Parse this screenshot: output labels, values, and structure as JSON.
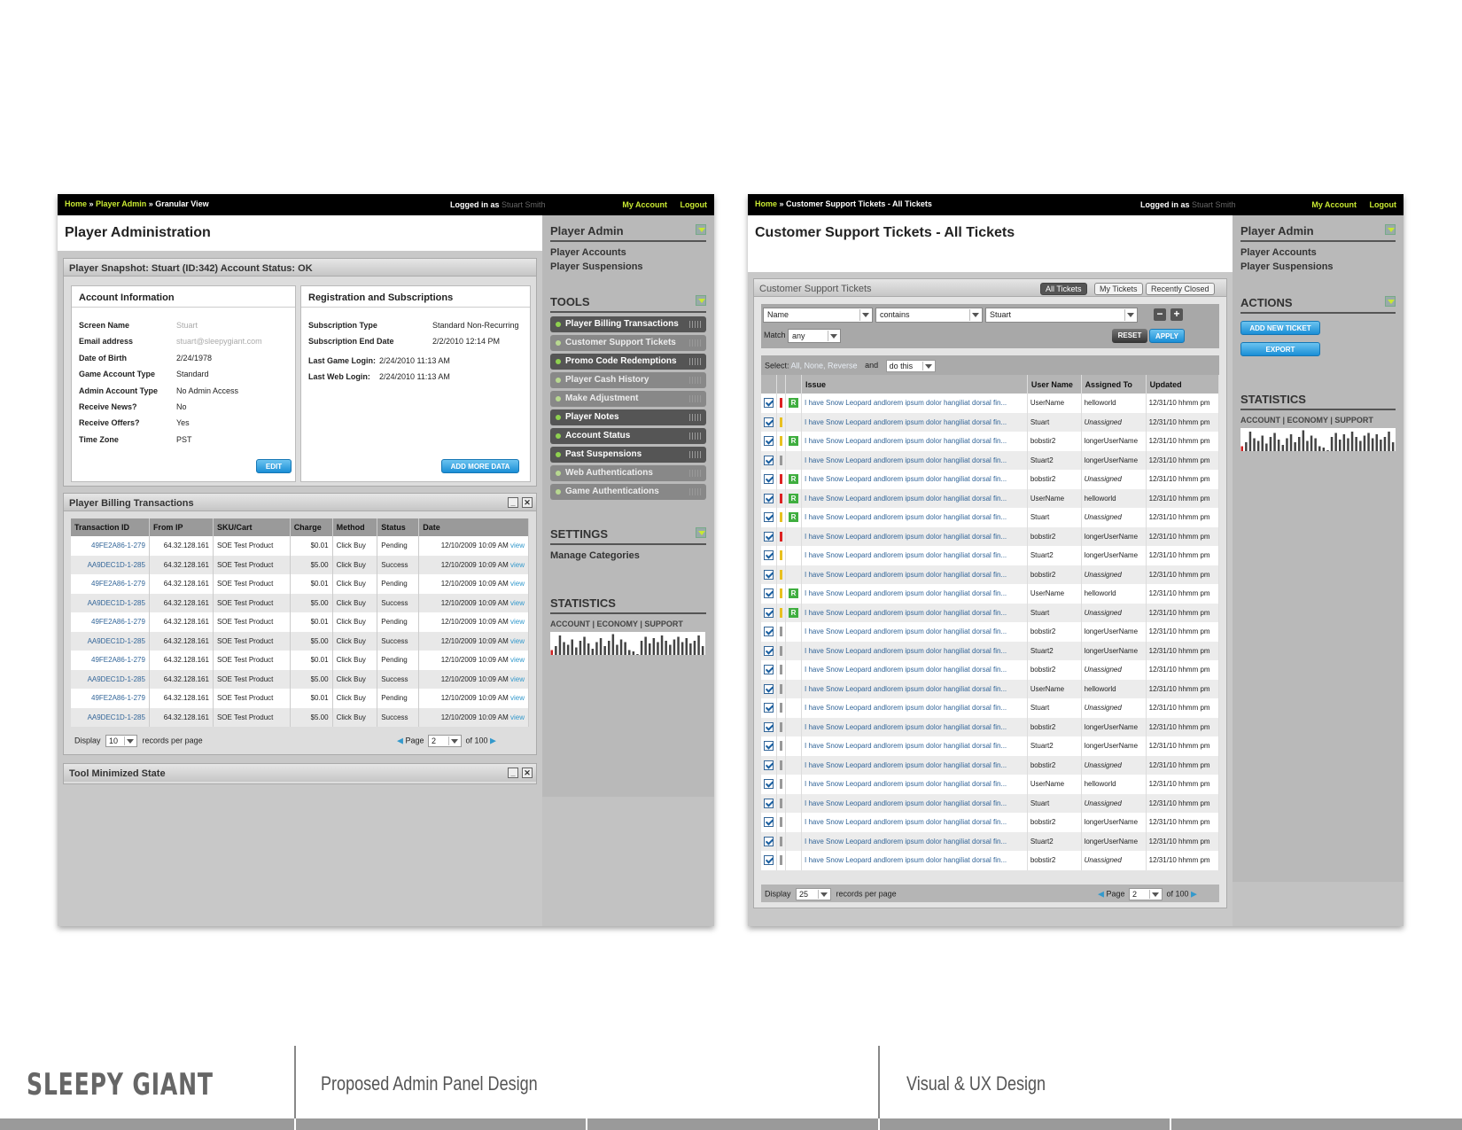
{
  "left": {
    "crumbs": {
      "home": "Home",
      "sep1": " » ",
      "admin": "Player Admin",
      "sep2": " » ",
      "current": "Granular View"
    },
    "login": {
      "label": "Logged in as ",
      "user": "Stuart Smith"
    },
    "my_account": "My Account",
    "logout": "Logout",
    "page_title": "Player Administration",
    "snapshot_title": "Player Snapshot: Stuart (ID:342) Account Status: OK",
    "account_info": {
      "title": "Account Information",
      "rows": [
        {
          "k": "Screen Name",
          "v": "Stuart"
        },
        {
          "k": "Email address",
          "v": "stuart@sleepygiant.com"
        },
        {
          "k": "Date of Birth",
          "v": "2/24/1978"
        },
        {
          "k": "Game Account Type",
          "v": "Standard"
        },
        {
          "k": "Admin Account Type",
          "v": "No Admin Access"
        },
        {
          "k": "Receive News?",
          "v": "No"
        },
        {
          "k": "Receive Offers?",
          "v": "Yes"
        },
        {
          "k": "Time Zone",
          "v": "PST"
        }
      ],
      "edit": "EDIT"
    },
    "registration": {
      "title": "Registration and Subscriptions",
      "rows": [
        {
          "k": "Subscription Type",
          "v": "Standard Non-Recurring"
        },
        {
          "k": "Subscription End Date",
          "v": "2/2/2010 12:14 PM"
        },
        {
          "k": "Last Game Login:",
          "v": "2/24/2010 11:13 AM"
        },
        {
          "k": "Last Web Login:",
          "v": "2/24/2010 11:13 AM"
        }
      ],
      "add": "ADD MORE DATA"
    },
    "billing": {
      "title": "Player Billing Transactions",
      "columns": [
        "Transaction ID",
        "From IP",
        "SKU/Cart",
        "Charge",
        "Method",
        "Status",
        "Date"
      ],
      "rows": [
        [
          "49FE2A86-1-279",
          "64.32.128.161",
          "SOE Test Product",
          "$0.01",
          "Click Buy",
          "Pending",
          "12/10/2009 10:09 AM"
        ],
        [
          "AA9DEC1D-1-285",
          "64.32.128.161",
          "SOE Test Product",
          "$5.00",
          "Click Buy",
          "Success",
          "12/10/2009 10:09 AM"
        ],
        [
          "49FE2A86-1-279",
          "64.32.128.161",
          "SOE Test Product",
          "$0.01",
          "Click Buy",
          "Pending",
          "12/10/2009 10:09 AM"
        ],
        [
          "AA9DEC1D-1-285",
          "64.32.128.161",
          "SOE Test Product",
          "$5.00",
          "Click Buy",
          "Success",
          "12/10/2009 10:09 AM"
        ],
        [
          "49FE2A86-1-279",
          "64.32.128.161",
          "SOE Test Product",
          "$0.01",
          "Click Buy",
          "Pending",
          "12/10/2009 10:09 AM"
        ],
        [
          "AA9DEC1D-1-285",
          "64.32.128.161",
          "SOE Test Product",
          "$5.00",
          "Click Buy",
          "Success",
          "12/10/2009 10:09 AM"
        ],
        [
          "49FE2A86-1-279",
          "64.32.128.161",
          "SOE Test Product",
          "$0.01",
          "Click Buy",
          "Pending",
          "12/10/2009 10:09 AM"
        ],
        [
          "AA9DEC1D-1-285",
          "64.32.128.161",
          "SOE Test Product",
          "$5.00",
          "Click Buy",
          "Success",
          "12/10/2009 10:09 AM"
        ],
        [
          "49FE2A86-1-279",
          "64.32.128.161",
          "SOE Test Product",
          "$0.01",
          "Click Buy",
          "Pending",
          "12/10/2009 10:09 AM"
        ],
        [
          "AA9DEC1D-1-285",
          "64.32.128.161",
          "SOE Test Product",
          "$5.00",
          "Click Buy",
          "Success",
          "12/10/2009 10:09 AM"
        ]
      ],
      "view": "view",
      "display_label": "Display",
      "display_value": "10",
      "records_label": "records per page",
      "page_label": "Page",
      "page_value": "2",
      "of_label": "of 100"
    },
    "minimized_title": "Tool Minimized State",
    "sidebar": {
      "player_admin": "Player Admin",
      "links": [
        "Player Accounts",
        "Player Suspensions"
      ],
      "tools_title": "TOOLS",
      "tools": [
        {
          "label": "Player Billing Transactions",
          "style": "dk"
        },
        {
          "label": "Customer Support Tickets",
          "style": "lt"
        },
        {
          "label": "Promo Code Redemptions",
          "style": "dk"
        },
        {
          "label": "Player Cash History",
          "style": "lt"
        },
        {
          "label": "Make Adjustment",
          "style": "lt"
        },
        {
          "label": "Player Notes",
          "style": "dk"
        },
        {
          "label": "Account Status",
          "style": "dk"
        },
        {
          "label": "Past Suspensions",
          "style": "dk"
        },
        {
          "label": "Web Authentications",
          "style": "lt"
        },
        {
          "label": "Game Authentications",
          "style": "lt"
        }
      ],
      "settings_title": "SETTINGS",
      "settings_link": "Manage Categories",
      "stats_title": "STATISTICS",
      "stats_sub": "ACCOUNT | ECONOMY | SUPPORT"
    }
  },
  "right": {
    "crumbs": {
      "home": "Home",
      "sep1": " » ",
      "current": "Customer Support Tickets - All Tickets"
    },
    "login": {
      "label": "Logged in as ",
      "user": "Stuart Smith"
    },
    "my_account": "My Account",
    "logout": "Logout",
    "page_title": "Customer Support Tickets - All Tickets",
    "panel_title": "Customer Support Tickets",
    "tabs": [
      "All Tickets",
      "My Tickets",
      "Recently Closed"
    ],
    "filter": {
      "field": "Name",
      "op": "contains",
      "value": "Stuart",
      "match_label": "Match",
      "match_value": "any",
      "reset": "RESET",
      "apply": "APPLY",
      "minus": "−",
      "plus": "+"
    },
    "select": {
      "label": "Select: ",
      "opts": "All, None, Reverse",
      "and": "and",
      "action": "do this"
    },
    "columns": [
      "Issue",
      "User Name",
      "Assigned To",
      "Updated"
    ],
    "issue_text": "I have Snow Leopard andlorem ipsum dolor hangiliat dorsal fin...",
    "updated": "12/31/10 hhmm pm",
    "unassigned": "Unassigned",
    "rows": [
      {
        "p": "#d22",
        "r": true,
        "u": "UserName",
        "a": "helloworld"
      },
      {
        "p": "#e8c020",
        "r": false,
        "u": "Stuart",
        "a": "Unassigned"
      },
      {
        "p": "#e8c020",
        "r": true,
        "u": "bobstir2",
        "a": "longerUserName"
      },
      {
        "p": "#999",
        "r": false,
        "u": "Stuart2",
        "a": "longerUserName"
      },
      {
        "p": "#d22",
        "r": true,
        "u": "bobstir2",
        "a": "Unassigned"
      },
      {
        "p": "#d22",
        "r": true,
        "u": "UserName",
        "a": "helloworld"
      },
      {
        "p": "#e8c020",
        "r": true,
        "u": "Stuart",
        "a": "Unassigned"
      },
      {
        "p": "#d22",
        "r": false,
        "u": "bobstir2",
        "a": "longerUserName"
      },
      {
        "p": "#e8c020",
        "r": false,
        "u": "Stuart2",
        "a": "longerUserName"
      },
      {
        "p": "#e8c020",
        "r": false,
        "u": "bobstir2",
        "a": "Unassigned"
      },
      {
        "p": "#e8c020",
        "r": true,
        "u": "UserName",
        "a": "helloworld"
      },
      {
        "p": "#e8c020",
        "r": true,
        "u": "Stuart",
        "a": "Unassigned"
      },
      {
        "p": "#999",
        "r": false,
        "u": "bobstir2",
        "a": "longerUserName"
      },
      {
        "p": "#999",
        "r": false,
        "u": "Stuart2",
        "a": "longerUserName"
      },
      {
        "p": "#999",
        "r": false,
        "u": "bobstir2",
        "a": "Unassigned"
      },
      {
        "p": "#999",
        "r": false,
        "u": "UserName",
        "a": "helloworld"
      },
      {
        "p": "#999",
        "r": false,
        "u": "Stuart",
        "a": "Unassigned"
      },
      {
        "p": "#999",
        "r": false,
        "u": "bobstir2",
        "a": "longerUserName"
      },
      {
        "p": "#999",
        "r": false,
        "u": "Stuart2",
        "a": "longerUserName"
      },
      {
        "p": "#999",
        "r": false,
        "u": "bobstir2",
        "a": "Unassigned"
      },
      {
        "p": "#999",
        "r": false,
        "u": "UserName",
        "a": "helloworld"
      },
      {
        "p": "#999",
        "r": false,
        "u": "Stuart",
        "a": "Unassigned"
      },
      {
        "p": "#999",
        "r": false,
        "u": "bobstir2",
        "a": "longerUserName"
      },
      {
        "p": "#999",
        "r": false,
        "u": "Stuart2",
        "a": "longerUserName"
      },
      {
        "p": "#999",
        "r": false,
        "u": "bobstir2",
        "a": "Unassigned"
      }
    ],
    "display_label": "Display",
    "display_value": "25",
    "records_label": "records per page",
    "page_label": "Page",
    "page_value": "2",
    "of_label": "of 100",
    "sidebar": {
      "player_admin": "Player Admin",
      "links": [
        "Player Accounts",
        "Player Suspensions"
      ],
      "actions_title": "ACTIONS",
      "add_ticket": "ADD NEW TICKET",
      "export": "EXPORT",
      "stats_title": "STATISTICS",
      "stats_sub": "ACCOUNT | ECONOMY | SUPPORT"
    }
  },
  "footer": {
    "brand": "SLEEPY GIANT",
    "project": "Proposed Admin Panel Design",
    "discipline": "Visual & UX Design"
  },
  "colors": {
    "accent": "#c8e832",
    "link": "#336699",
    "button_blue": "#1a8ed6"
  },
  "spark_values": [
    3,
    6,
    14,
    9,
    7,
    11,
    5,
    10,
    13,
    8,
    4,
    9,
    12,
    6,
    10,
    15,
    7,
    11,
    9,
    3,
    2,
    0,
    10,
    13,
    8,
    12,
    9,
    14,
    10,
    7,
    11,
    13,
    9,
    12,
    8,
    10,
    14,
    6
  ]
}
